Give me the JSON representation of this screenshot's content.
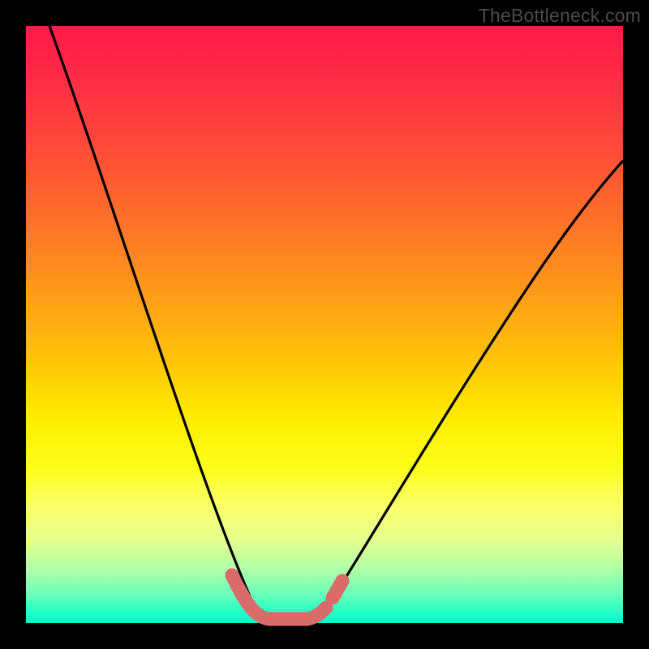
{
  "watermark": {
    "text": "TheBottleneck.com"
  },
  "colors": {
    "background": "#000000",
    "curve": "#000000",
    "marker": "#d96b6b",
    "gradient_stops": [
      "#ff1a4a",
      "#ff2a47",
      "#ff5833",
      "#ff8a20",
      "#ffc00a",
      "#ffe900",
      "#fbff18",
      "#fbff66",
      "#e6ff8f",
      "#b0ffa7",
      "#6dffb9",
      "#28ffc5",
      "#00ffcc"
    ]
  },
  "chart_data": {
    "type": "line",
    "title": "",
    "xlabel": "",
    "ylabel": "",
    "xlim": [
      0,
      100
    ],
    "ylim": [
      0,
      100
    ],
    "note": "Axes are unlabeled; x interpreted left→right 0–100, y bottom→top 0–100 (0 = green baseline, 100 = top of gradient).",
    "series": [
      {
        "name": "left-branch",
        "x": [
          4,
          8,
          12,
          16,
          20,
          24,
          28,
          32,
          35,
          37,
          38.5
        ],
        "y": [
          100,
          87,
          74,
          61,
          48,
          36,
          25,
          15,
          8,
          3,
          1
        ]
      },
      {
        "name": "bottom-flat",
        "x": [
          38.5,
          40,
          42,
          44,
          46,
          48
        ],
        "y": [
          1,
          0.5,
          0.3,
          0.3,
          0.4,
          0.8
        ]
      },
      {
        "name": "right-branch",
        "x": [
          48,
          52,
          58,
          64,
          70,
          76,
          82,
          88,
          94,
          100
        ],
        "y": [
          1.5,
          6,
          15,
          25,
          35,
          45,
          54,
          62,
          70,
          77
        ]
      }
    ],
    "markers": {
      "name": "bottom-highlight",
      "color": "#d96b6b",
      "points_x": [
        35.5,
        37,
        38.5,
        40,
        42,
        44,
        46,
        48,
        49.5,
        50.5
      ],
      "points_y": [
        6,
        3,
        1.2,
        0.6,
        0.4,
        0.4,
        0.5,
        1.0,
        2.2,
        4.2
      ]
    }
  }
}
